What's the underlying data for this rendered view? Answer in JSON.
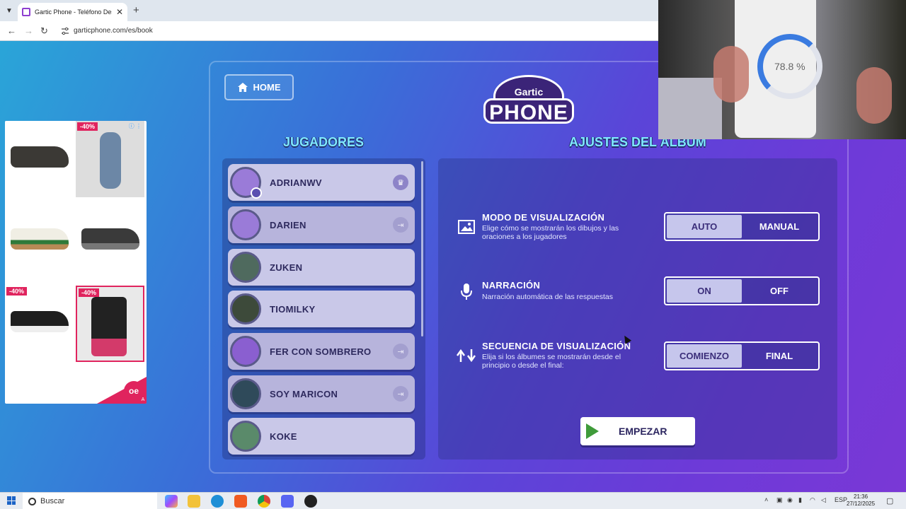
{
  "browser": {
    "tab_title": "Gartic Phone - Teléfono Descon",
    "url": "garticphone.com/es/book"
  },
  "ad": {
    "discounts": [
      "-40%",
      "-40%",
      "-40%"
    ],
    "brand": "oe"
  },
  "game": {
    "home_label": "HOME",
    "logo_line1": "Gartic",
    "logo_line2": "PHONE",
    "players_title": "JUGADORES",
    "settings_title": "AJUSTES DEL ÁLBUM",
    "players": [
      {
        "name": "ADRIANWV",
        "badge": "crown"
      },
      {
        "name": "DARIEN",
        "badge": "kick"
      },
      {
        "name": "ZUKEN",
        "badge": ""
      },
      {
        "name": "TIOMILKY",
        "badge": ""
      },
      {
        "name": "FER CON SOMBRERO",
        "badge": "kick"
      },
      {
        "name": "SOY MARICON",
        "badge": "kick"
      },
      {
        "name": "KOKE",
        "badge": ""
      }
    ],
    "settings": [
      {
        "title": "MODO DE VISUALIZACIÓN",
        "desc": "Elige cómo se mostrarán los dibujos y las oraciones a los jugadores",
        "opt_a": "AUTO",
        "opt_b": "MANUAL",
        "selected": "AUTO"
      },
      {
        "title": "NARRACIÓN",
        "desc": "Narración automática de las respuestas",
        "opt_a": "ON",
        "opt_b": "OFF",
        "selected": "ON"
      },
      {
        "title": "SECUENCIA DE VISUALIZACIÓN",
        "desc": "Elija si los álbumes se mostrarán desde el principio o desde el final:",
        "opt_a": "COMIENZO",
        "opt_b": "FINAL",
        "selected": "COMIENZO"
      }
    ],
    "start_label": "EMPEZAR"
  },
  "webcam": {
    "gauge_value": "78.8 %"
  },
  "taskbar": {
    "search_label": "Buscar",
    "lang": "ESP",
    "time": "21:36",
    "date": "27/12/2025"
  },
  "colors": {
    "title_cyan": "#7fe8ff",
    "player_card": "#c9c8e8",
    "toggle_selected": "#c6c6ec",
    "start_play_green": "#3f9b3a",
    "ad_pink": "#e0245e"
  }
}
